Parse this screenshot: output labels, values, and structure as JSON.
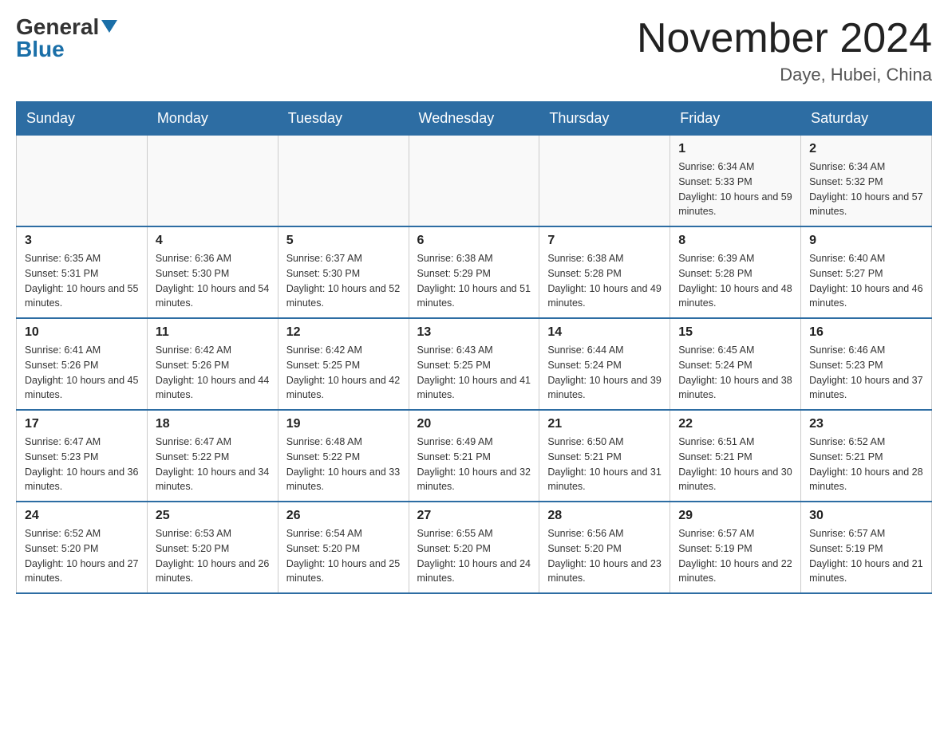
{
  "header": {
    "logo_general": "General",
    "logo_blue": "Blue",
    "month_title": "November 2024",
    "location": "Daye, Hubei, China"
  },
  "days_of_week": [
    "Sunday",
    "Monday",
    "Tuesday",
    "Wednesday",
    "Thursday",
    "Friday",
    "Saturday"
  ],
  "weeks": [
    [
      {
        "day": "",
        "sunrise": "",
        "sunset": "",
        "daylight": ""
      },
      {
        "day": "",
        "sunrise": "",
        "sunset": "",
        "daylight": ""
      },
      {
        "day": "",
        "sunrise": "",
        "sunset": "",
        "daylight": ""
      },
      {
        "day": "",
        "sunrise": "",
        "sunset": "",
        "daylight": ""
      },
      {
        "day": "",
        "sunrise": "",
        "sunset": "",
        "daylight": ""
      },
      {
        "day": "1",
        "sunrise": "Sunrise: 6:34 AM",
        "sunset": "Sunset: 5:33 PM",
        "daylight": "Daylight: 10 hours and 59 minutes."
      },
      {
        "day": "2",
        "sunrise": "Sunrise: 6:34 AM",
        "sunset": "Sunset: 5:32 PM",
        "daylight": "Daylight: 10 hours and 57 minutes."
      }
    ],
    [
      {
        "day": "3",
        "sunrise": "Sunrise: 6:35 AM",
        "sunset": "Sunset: 5:31 PM",
        "daylight": "Daylight: 10 hours and 55 minutes."
      },
      {
        "day": "4",
        "sunrise": "Sunrise: 6:36 AM",
        "sunset": "Sunset: 5:30 PM",
        "daylight": "Daylight: 10 hours and 54 minutes."
      },
      {
        "day": "5",
        "sunrise": "Sunrise: 6:37 AM",
        "sunset": "Sunset: 5:30 PM",
        "daylight": "Daylight: 10 hours and 52 minutes."
      },
      {
        "day": "6",
        "sunrise": "Sunrise: 6:38 AM",
        "sunset": "Sunset: 5:29 PM",
        "daylight": "Daylight: 10 hours and 51 minutes."
      },
      {
        "day": "7",
        "sunrise": "Sunrise: 6:38 AM",
        "sunset": "Sunset: 5:28 PM",
        "daylight": "Daylight: 10 hours and 49 minutes."
      },
      {
        "day": "8",
        "sunrise": "Sunrise: 6:39 AM",
        "sunset": "Sunset: 5:28 PM",
        "daylight": "Daylight: 10 hours and 48 minutes."
      },
      {
        "day": "9",
        "sunrise": "Sunrise: 6:40 AM",
        "sunset": "Sunset: 5:27 PM",
        "daylight": "Daylight: 10 hours and 46 minutes."
      }
    ],
    [
      {
        "day": "10",
        "sunrise": "Sunrise: 6:41 AM",
        "sunset": "Sunset: 5:26 PM",
        "daylight": "Daylight: 10 hours and 45 minutes."
      },
      {
        "day": "11",
        "sunrise": "Sunrise: 6:42 AM",
        "sunset": "Sunset: 5:26 PM",
        "daylight": "Daylight: 10 hours and 44 minutes."
      },
      {
        "day": "12",
        "sunrise": "Sunrise: 6:42 AM",
        "sunset": "Sunset: 5:25 PM",
        "daylight": "Daylight: 10 hours and 42 minutes."
      },
      {
        "day": "13",
        "sunrise": "Sunrise: 6:43 AM",
        "sunset": "Sunset: 5:25 PM",
        "daylight": "Daylight: 10 hours and 41 minutes."
      },
      {
        "day": "14",
        "sunrise": "Sunrise: 6:44 AM",
        "sunset": "Sunset: 5:24 PM",
        "daylight": "Daylight: 10 hours and 39 minutes."
      },
      {
        "day": "15",
        "sunrise": "Sunrise: 6:45 AM",
        "sunset": "Sunset: 5:24 PM",
        "daylight": "Daylight: 10 hours and 38 minutes."
      },
      {
        "day": "16",
        "sunrise": "Sunrise: 6:46 AM",
        "sunset": "Sunset: 5:23 PM",
        "daylight": "Daylight: 10 hours and 37 minutes."
      }
    ],
    [
      {
        "day": "17",
        "sunrise": "Sunrise: 6:47 AM",
        "sunset": "Sunset: 5:23 PM",
        "daylight": "Daylight: 10 hours and 36 minutes."
      },
      {
        "day": "18",
        "sunrise": "Sunrise: 6:47 AM",
        "sunset": "Sunset: 5:22 PM",
        "daylight": "Daylight: 10 hours and 34 minutes."
      },
      {
        "day": "19",
        "sunrise": "Sunrise: 6:48 AM",
        "sunset": "Sunset: 5:22 PM",
        "daylight": "Daylight: 10 hours and 33 minutes."
      },
      {
        "day": "20",
        "sunrise": "Sunrise: 6:49 AM",
        "sunset": "Sunset: 5:21 PM",
        "daylight": "Daylight: 10 hours and 32 minutes."
      },
      {
        "day": "21",
        "sunrise": "Sunrise: 6:50 AM",
        "sunset": "Sunset: 5:21 PM",
        "daylight": "Daylight: 10 hours and 31 minutes."
      },
      {
        "day": "22",
        "sunrise": "Sunrise: 6:51 AM",
        "sunset": "Sunset: 5:21 PM",
        "daylight": "Daylight: 10 hours and 30 minutes."
      },
      {
        "day": "23",
        "sunrise": "Sunrise: 6:52 AM",
        "sunset": "Sunset: 5:21 PM",
        "daylight": "Daylight: 10 hours and 28 minutes."
      }
    ],
    [
      {
        "day": "24",
        "sunrise": "Sunrise: 6:52 AM",
        "sunset": "Sunset: 5:20 PM",
        "daylight": "Daylight: 10 hours and 27 minutes."
      },
      {
        "day": "25",
        "sunrise": "Sunrise: 6:53 AM",
        "sunset": "Sunset: 5:20 PM",
        "daylight": "Daylight: 10 hours and 26 minutes."
      },
      {
        "day": "26",
        "sunrise": "Sunrise: 6:54 AM",
        "sunset": "Sunset: 5:20 PM",
        "daylight": "Daylight: 10 hours and 25 minutes."
      },
      {
        "day": "27",
        "sunrise": "Sunrise: 6:55 AM",
        "sunset": "Sunset: 5:20 PM",
        "daylight": "Daylight: 10 hours and 24 minutes."
      },
      {
        "day": "28",
        "sunrise": "Sunrise: 6:56 AM",
        "sunset": "Sunset: 5:20 PM",
        "daylight": "Daylight: 10 hours and 23 minutes."
      },
      {
        "day": "29",
        "sunrise": "Sunrise: 6:57 AM",
        "sunset": "Sunset: 5:19 PM",
        "daylight": "Daylight: 10 hours and 22 minutes."
      },
      {
        "day": "30",
        "sunrise": "Sunrise: 6:57 AM",
        "sunset": "Sunset: 5:19 PM",
        "daylight": "Daylight: 10 hours and 21 minutes."
      }
    ]
  ]
}
